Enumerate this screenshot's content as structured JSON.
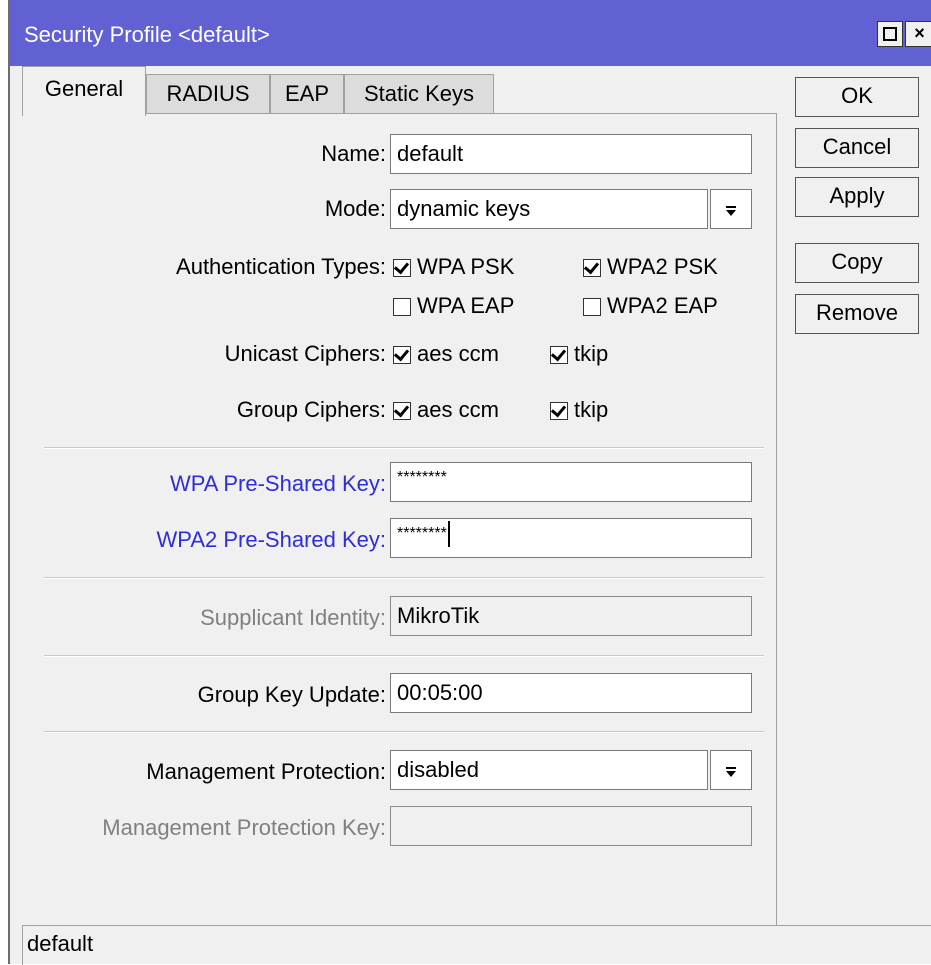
{
  "window": {
    "title": "Security Profile <default>",
    "titlebar_color": "#6161d4"
  },
  "tabs": [
    {
      "label": "General",
      "active": true
    },
    {
      "label": "RADIUS",
      "active": false
    },
    {
      "label": "EAP",
      "active": false
    },
    {
      "label": "Static Keys",
      "active": false
    }
  ],
  "form": {
    "name": {
      "label": "Name:",
      "value": "default"
    },
    "mode": {
      "label": "Mode:",
      "value": "dynamic keys"
    },
    "auth_types": {
      "label": "Authentication Types:",
      "options": [
        {
          "label": "WPA PSK",
          "checked": true
        },
        {
          "label": "WPA2 PSK",
          "checked": true
        },
        {
          "label": "WPA EAP",
          "checked": false
        },
        {
          "label": "WPA2 EAP",
          "checked": false
        }
      ]
    },
    "unicast_ciphers": {
      "label": "Unicast Ciphers:",
      "options": [
        {
          "label": "aes ccm",
          "checked": true
        },
        {
          "label": "tkip",
          "checked": true
        }
      ]
    },
    "group_ciphers": {
      "label": "Group Ciphers:",
      "options": [
        {
          "label": "aes ccm",
          "checked": true
        },
        {
          "label": "tkip",
          "checked": true
        }
      ]
    },
    "wpa_psk": {
      "label": "WPA Pre-Shared Key:",
      "value": "********"
    },
    "wpa2_psk": {
      "label": "WPA2 Pre-Shared Key:",
      "value": "********"
    },
    "supplicant_identity": {
      "label": "Supplicant Identity:",
      "value": "MikroTik"
    },
    "group_key_update": {
      "label": "Group Key Update:",
      "value": "00:05:00"
    },
    "mgmt_protection": {
      "label": "Management Protection:",
      "value": "disabled"
    },
    "mgmt_protection_key": {
      "label": "Management Protection Key:",
      "value": ""
    }
  },
  "buttons": {
    "ok": "OK",
    "cancel": "Cancel",
    "apply": "Apply",
    "copy": "Copy",
    "remove": "Remove"
  },
  "status": {
    "text": "default"
  },
  "colors": {
    "link_label": "#2e2ed8",
    "disabled_label": "#808080"
  }
}
